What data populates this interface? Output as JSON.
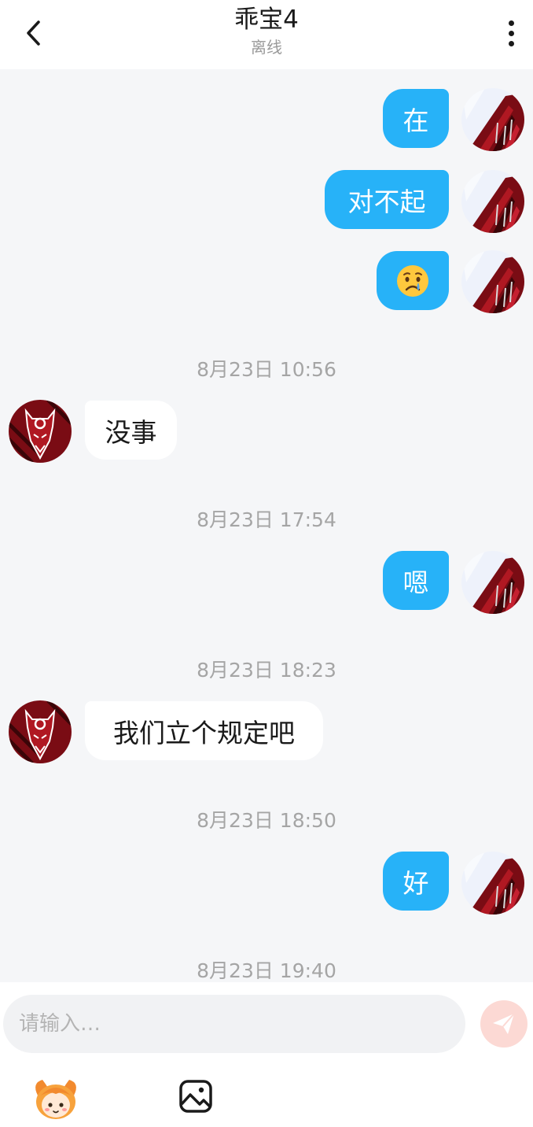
{
  "header": {
    "title": "乖宝4",
    "status": "离线",
    "back_icon": "chevron-left-icon",
    "more_icon": "more-vertical-icon"
  },
  "messages": [
    {
      "sender": "me",
      "text": "在"
    },
    {
      "sender": "me",
      "text": "对不起"
    },
    {
      "sender": "me",
      "text": "😢",
      "emoji_name": "crying-face"
    },
    {
      "timestamp": "8月23日 10:56"
    },
    {
      "sender": "other",
      "text": "没事"
    },
    {
      "timestamp": "8月23日 17:54"
    },
    {
      "sender": "me",
      "text": "嗯"
    },
    {
      "timestamp": "8月23日 18:23"
    },
    {
      "sender": "other",
      "text": "我们立个规定吧"
    },
    {
      "timestamp": "8月23日 18:50"
    },
    {
      "sender": "me",
      "text": "好"
    },
    {
      "timestamp": "8月23日 19:40"
    }
  ],
  "input": {
    "placeholder": "请输入…",
    "value": "",
    "send_icon": "paper-plane-icon"
  },
  "toolbar": {
    "sticker_icon": "cartoon-sticker-icon",
    "image_icon": "image-icon"
  },
  "colors": {
    "my_bubble": "#27b2f8",
    "other_bubble": "#ffffff",
    "chat_background": "#f5f6f8",
    "send_button": "#fcd9d4"
  }
}
